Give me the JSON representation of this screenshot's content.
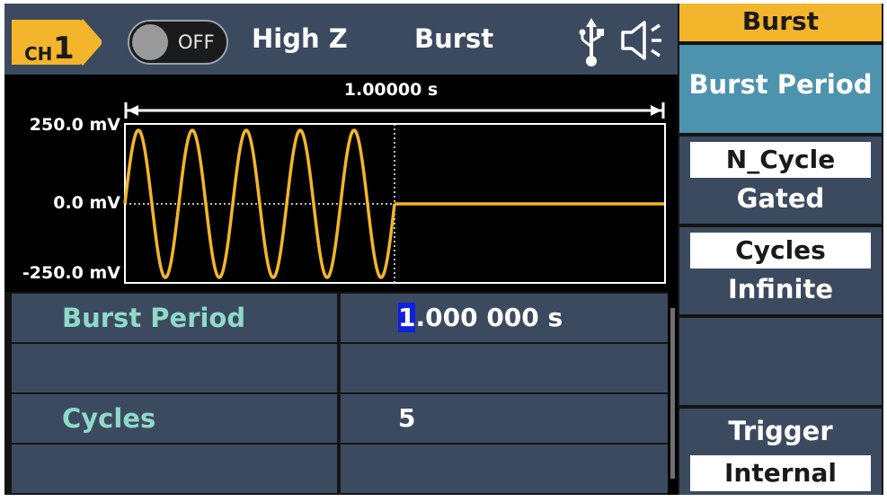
{
  "top_bar": {
    "channel_prefix": "CH",
    "channel_number": "1",
    "output_state": "OFF",
    "impedance": "High Z",
    "mode": "Burst",
    "icons": [
      "usb-icon",
      "speaker-icon"
    ]
  },
  "waveform": {
    "period_label": "1.00000 s",
    "y_labels": [
      "250.0 mV",
      "0.0 mV",
      "-250.0 mV"
    ],
    "cycles_shown": 5,
    "wave_color": "#f2b52b"
  },
  "params": {
    "rows": [
      {
        "name": "Burst Period",
        "value_cursor": "1",
        "value_rest": ".000 000 s"
      },
      {
        "name": "",
        "value_cursor": "",
        "value_rest": ""
      },
      {
        "name": "Cycles",
        "value_cursor": "",
        "value_rest": "5"
      },
      {
        "name": "",
        "value_cursor": "",
        "value_rest": ""
      }
    ]
  },
  "menu": {
    "title": "Burst",
    "burst_period": "Burst Period",
    "ncycle_selected": "N_Cycle",
    "ncycle_other": "Gated",
    "cycles_selected": "Cycles",
    "cycles_other": "Infinite",
    "trigger_label": "Trigger",
    "trigger_value": "Internal"
  },
  "colors": {
    "accent": "#f2b52b",
    "panel": "#3c4a5f",
    "highlight": "#4d93ad",
    "param_name": "#8fd9c9"
  }
}
